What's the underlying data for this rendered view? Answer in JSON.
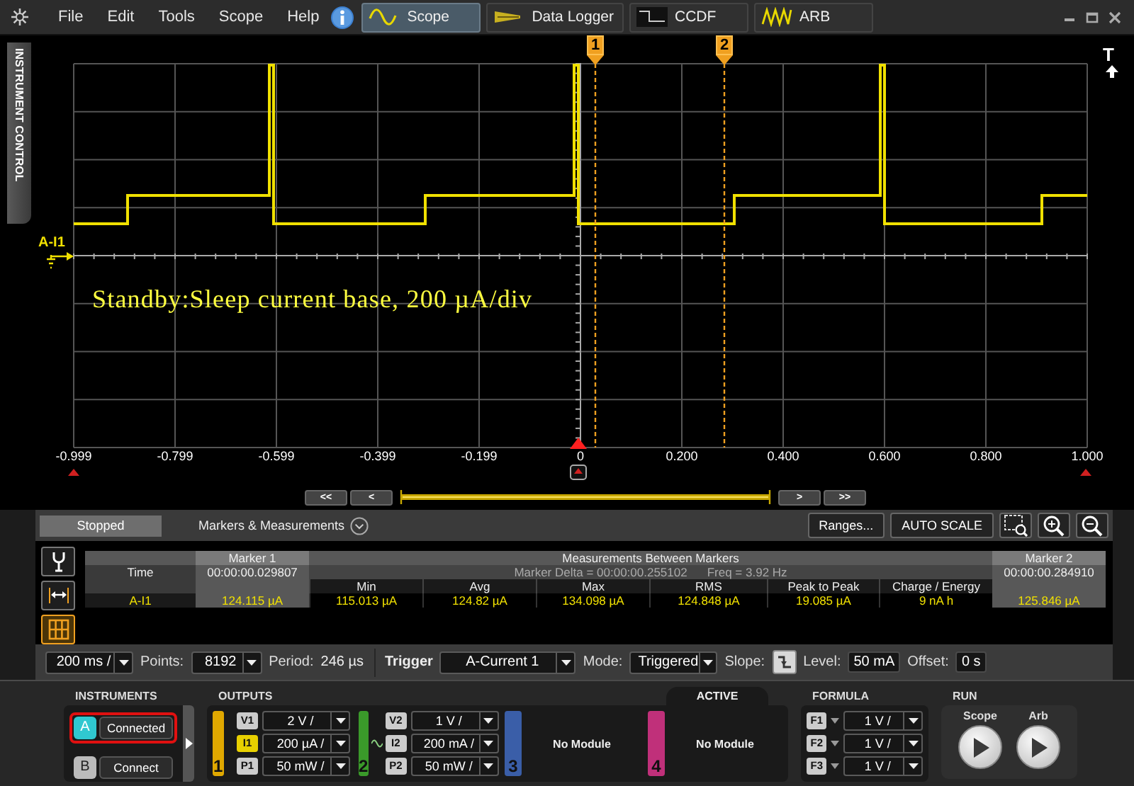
{
  "menu": [
    "File",
    "Edit",
    "Tools",
    "Scope",
    "Help"
  ],
  "tabs": [
    {
      "label": "Scope",
      "selected": true
    },
    {
      "label": "Data Logger",
      "selected": false
    },
    {
      "label": "CCDF",
      "selected": false
    },
    {
      "label": "ARB",
      "selected": false
    }
  ],
  "side_tab": "INSTRUMENT CONTROL",
  "plot": {
    "markers": [
      "1",
      "2"
    ],
    "trigger_mark": "T",
    "channel": "A-I1",
    "annotation": "Standby:Sleep current base, 200 µA/div",
    "x_labels": [
      "-0.999",
      "-0.799",
      "-0.599",
      "-0.399",
      "-0.199",
      "0",
      "0.200",
      "0.400",
      "0.600",
      "0.800",
      "1.000"
    ]
  },
  "nav_buttons": [
    "<<",
    "<",
    ">",
    ">>"
  ],
  "panel": {
    "status": "Stopped",
    "title": "Markers & Measurements",
    "buttons": [
      "Ranges...",
      "AUTO SCALE"
    ]
  },
  "side_tools": [
    {
      "selected": false
    },
    {
      "selected": false
    },
    {
      "selected": true
    }
  ],
  "measurements": {
    "marker_1": "Marker 1",
    "between": "Measurements Between Markers",
    "marker_2": "Marker 2",
    "time_label": "Time",
    "marker_1_time": "00:00:00.029807",
    "delta": "Marker Delta = 00:00:00.255102",
    "freq": "Freq = 3.92 Hz",
    "marker_2_time": "00:00:00.284910",
    "columns": [
      "Min",
      "Avg",
      "Max",
      "RMS",
      "Peak to Peak",
      "Charge / Energy"
    ],
    "rows": [
      {
        "label": "A-I1",
        "marker_1": "124.115 µA",
        "values": [
          "115.013 µA",
          "124.82 µA",
          "134.098 µA",
          "124.848 µA",
          "19.085 µA",
          "9 nA h"
        ],
        "marker_2": "125.846 µA"
      }
    ]
  },
  "toolbar": {
    "timebase": "200 ms /",
    "points_label": "Points:",
    "points": "8192",
    "period_label": "Period:",
    "period": "246 µs",
    "trigger_label": "Trigger",
    "trigger_source": "A-Current 1",
    "mode_label": "Mode:",
    "mode": "Triggered",
    "slope_label": "Slope:",
    "trigger_level_label": "Level:",
    "trigger_level": "50 mA",
    "offset_label": "Offset:",
    "offset": "0 s"
  },
  "instruments": {
    "title": "INSTRUMENTS",
    "items": [
      {
        "letter": "A",
        "status": "Connected",
        "selected": true
      },
      {
        "letter": "B",
        "status": "Connect",
        "selected": false
      }
    ]
  },
  "outputs": {
    "title": "OUTPUTS",
    "active_label": "ACTIVE",
    "modules": [
      {
        "number": "1",
        "color": "#e0a800",
        "kind": "module",
        "source_icon": false,
        "rows": [
          {
            "label": "V1",
            "value": "2 V /",
            "selected": false
          },
          {
            "label": "I1",
            "value": "200 µA /",
            "selected": true
          },
          {
            "label": "P1",
            "value": "50 mW /",
            "selected": false
          }
        ]
      },
      {
        "number": "2",
        "color": "#3a9a2a",
        "kind": "module",
        "source_icon": true,
        "rows": [
          {
            "label": "V2",
            "value": "1 V /",
            "selected": false
          },
          {
            "label": "I2",
            "value": "200 mA /",
            "selected": false
          },
          {
            "label": "P2",
            "value": "50 mW /",
            "selected": false
          }
        ]
      },
      {
        "number": "3",
        "color": "#3a5ea8",
        "kind": "empty",
        "text": "No Module"
      },
      {
        "number": "4",
        "color": "#c0307a",
        "kind": "empty",
        "text": "No Module"
      }
    ]
  },
  "formula": {
    "title": "FORMULA",
    "items": [
      {
        "label": "F1",
        "value": "1 V /"
      },
      {
        "label": "F2",
        "value": "1 V /"
      },
      {
        "label": "F3",
        "value": "1 V /"
      }
    ]
  },
  "run": {
    "title": "RUN",
    "buttons": [
      "Scope",
      "Arb"
    ]
  }
}
